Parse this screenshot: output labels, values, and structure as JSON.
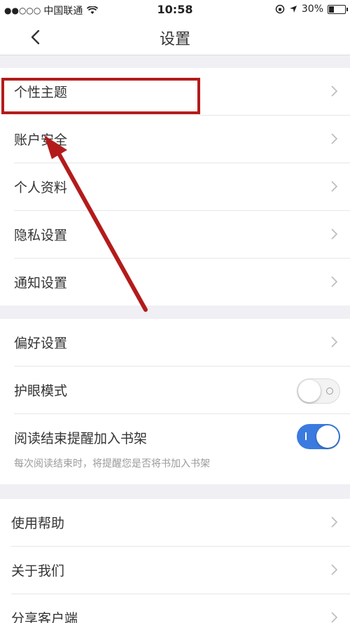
{
  "status_bar": {
    "signal": "●●○○○",
    "carrier": "中国联通",
    "wifi_icon": "wifi-icon",
    "time": "10:58",
    "battery": "30%",
    "battery_level": 0.3
  },
  "nav": {
    "title": "设置",
    "back_icon": "chevron-left-icon"
  },
  "group1": [
    {
      "label": "个性主题"
    },
    {
      "label": "账户安全"
    },
    {
      "label": "个人资料"
    },
    {
      "label": "隐私设置"
    },
    {
      "label": "通知设置"
    }
  ],
  "group2": {
    "preferences": "偏好设置",
    "eye_mode": {
      "label": "护眼模式",
      "on": false
    },
    "bookshelf": {
      "label": "阅读结束提醒加入书架",
      "hint": "每次阅读结束时，将提醒您是否将书加入书架",
      "on": true
    }
  },
  "group3": [
    {
      "label": "使用帮助"
    },
    {
      "label": "关于我们"
    },
    {
      "label": "分享客户端"
    }
  ],
  "colors": {
    "accent": "#3b7be0",
    "annotation": "#b31b1b",
    "background": "#efeff4"
  }
}
